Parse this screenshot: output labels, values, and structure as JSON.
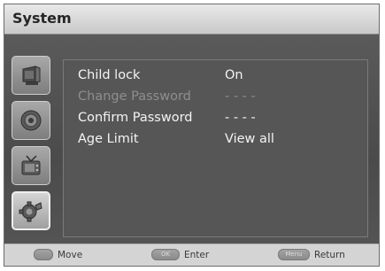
{
  "window": {
    "title": "System"
  },
  "sidebar": {
    "icons": [
      "picture-icon",
      "sound-icon",
      "channel-icon",
      "setup-icon"
    ],
    "active_index": 3
  },
  "menu": {
    "rows": [
      {
        "label": "Child lock",
        "value": "On",
        "enabled": true
      },
      {
        "label": "Change Password",
        "value": "- - - -",
        "enabled": false
      },
      {
        "label": "Confirm Password",
        "value": "- - - -",
        "enabled": true
      },
      {
        "label": "Age Limit",
        "value": "View all",
        "enabled": true
      }
    ]
  },
  "footer": {
    "move_label": "Move",
    "enter_key": "OK",
    "enter_label": "Enter",
    "return_key": "Menu",
    "return_label": "Return"
  }
}
